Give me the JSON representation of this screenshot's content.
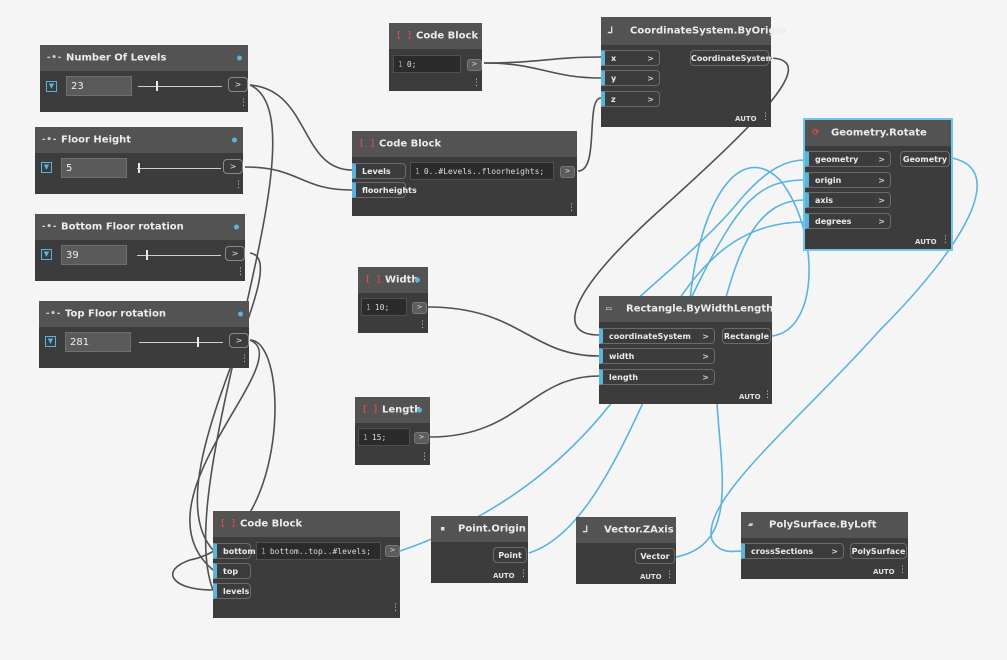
{
  "colors": {
    "wire": "#505050",
    "wire_active": "#5ab4dc",
    "node_body": "#3c3c3c",
    "node_header": "#535353",
    "accent": "#5ab4dc",
    "canvas": "#f5f5f5"
  },
  "sliders": [
    {
      "title": "Number Of Levels",
      "value": "23",
      "fraction": 0.2,
      "out": ">"
    },
    {
      "title": "Floor Height",
      "value": "5",
      "fraction": 0.0,
      "out": ">"
    },
    {
      "title": "Bottom Floor rotation",
      "value": "39",
      "fraction": 0.1,
      "out": ">"
    },
    {
      "title": "Top Floor rotation",
      "value": "281",
      "fraction": 0.78,
      "out": ">"
    }
  ],
  "nodes": {
    "code_top": {
      "title": "Code Block",
      "line": "1",
      "code": "0;"
    },
    "code_levels": {
      "title": "Code Block",
      "inputs": [
        "Levels",
        "floorheights"
      ],
      "line": "1",
      "code": "0..#Levels..floorheights;"
    },
    "width": {
      "title": "Width",
      "line": "1",
      "code": "10;"
    },
    "length": {
      "title": "Length",
      "line": "1",
      "code": "15;"
    },
    "code_bottom": {
      "title": "Code Block",
      "inputs": [
        "bottom",
        "top",
        "levels"
      ],
      "line": "1",
      "code": "bottom..top..#levels;"
    },
    "coordsys": {
      "title": "CoordinateSystem.ByOrigin",
      "inputs": [
        "x",
        "y",
        "z"
      ],
      "output": "CoordinateSystem",
      "lacing": "AUTO"
    },
    "rotate": {
      "title": "Geometry.Rotate",
      "inputs": [
        "geometry",
        "origin",
        "axis",
        "degrees"
      ],
      "output": "Geometry",
      "lacing": "AUTO"
    },
    "rect": {
      "title": "Rectangle.ByWidthLength",
      "inputs": [
        "coordinateSystem",
        "width",
        "length"
      ],
      "output": "Rectangle",
      "lacing": "AUTO"
    },
    "pointorigin": {
      "title": "Point.Origin",
      "output": "Point",
      "lacing": "AUTO"
    },
    "zaxis": {
      "title": "Vector.ZAxis",
      "output": "Vector",
      "lacing": "AUTO"
    },
    "loft": {
      "title": "PolySurface.ByLoft",
      "inputs": [
        "crossSections"
      ],
      "output": "PolySurface",
      "lacing": "AUTO"
    }
  },
  "icons": {
    "slider": "slider-icon",
    "code": "code-block-icon",
    "coord": "coordinate-system-icon",
    "rotate": "geometry-rotate-icon",
    "rect": "rectangle-icon",
    "point": "point-icon",
    "vector": "vector-icon",
    "loft": "polysurface-icon"
  }
}
